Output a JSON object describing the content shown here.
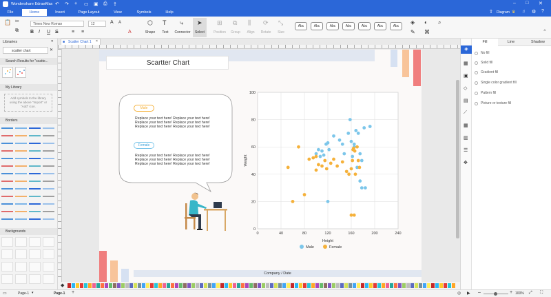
{
  "app": {
    "title": "Wondershare EdrawMax"
  },
  "menu": {
    "tabs": [
      "File",
      "Home",
      "Insert",
      "Page Layout",
      "View",
      "Symbols",
      "Help"
    ],
    "active": "Home",
    "diagram_label": "Diagram"
  },
  "ribbon": {
    "font_name": "Times New Roman",
    "font_size": "12",
    "tools": [
      "Shape",
      "Text",
      "Connector",
      "Select",
      "Position",
      "Group",
      "Align",
      "Rotate",
      "Size"
    ],
    "style_swatches": [
      "Abc",
      "Abc",
      "Abc",
      "Abc",
      "Abc",
      "Abc",
      "Abc"
    ]
  },
  "left_panel": {
    "title": "Libraries",
    "search_value": "scatter chart",
    "search_results_label": "Search Results for \"scatte...",
    "my_library_label": "My Library",
    "my_library_hint": "Add symbols to the library using the above \"Import\" or \"Add\" icon.",
    "borders_label": "Borders",
    "backgrounds_label": "Backgrounds"
  },
  "document_tab": {
    "label": "Scatter Chart 1"
  },
  "canvas": {
    "title": "Scartter Chart",
    "footer": "Company / Date",
    "bubble": {
      "male_label": "Male",
      "female_label": "Female",
      "placeholder": "Replace your text here!"
    }
  },
  "chart_data": {
    "type": "scatter",
    "title": "",
    "xlabel": "Height",
    "ylabel": "Weight",
    "xlim": [
      0,
      240
    ],
    "ylim": [
      0,
      100
    ],
    "x_ticks": [
      0,
      40,
      80,
      120,
      160,
      200,
      240
    ],
    "y_ticks": [
      0,
      20,
      40,
      60,
      80,
      100
    ],
    "grid": true,
    "legend_position": "bottom",
    "series": [
      {
        "name": "Male",
        "color": "#7cc6ea",
        "points": [
          [
            100,
            55
          ],
          [
            104,
            58
          ],
          [
            107,
            53
          ],
          [
            110,
            57
          ],
          [
            113,
            54
          ],
          [
            117,
            62
          ],
          [
            120,
            63
          ],
          [
            122,
            58
          ],
          [
            130,
            68
          ],
          [
            140,
            65
          ],
          [
            148,
            55
          ],
          [
            155,
            70
          ],
          [
            160,
            64
          ],
          [
            162,
            53
          ],
          [
            165,
            60
          ],
          [
            168,
            72
          ],
          [
            172,
            70
          ],
          [
            178,
            50
          ],
          [
            182,
            74
          ],
          [
            192,
            75
          ],
          [
            165,
            62
          ],
          [
            175,
            55
          ],
          [
            170,
            45
          ],
          [
            175,
            35
          ],
          [
            178,
            30
          ],
          [
            184,
            30
          ],
          [
            158,
            80
          ],
          [
            120,
            20
          ],
          [
            145,
            62
          ]
        ]
      },
      {
        "name": "Female",
        "color": "#f5b13a",
        "points": [
          [
            52,
            45
          ],
          [
            60,
            20
          ],
          [
            70,
            60
          ],
          [
            80,
            25
          ],
          [
            88,
            51
          ],
          [
            95,
            52
          ],
          [
            100,
            43
          ],
          [
            104,
            47
          ],
          [
            110,
            46
          ],
          [
            115,
            50
          ],
          [
            118,
            44
          ],
          [
            125,
            48
          ],
          [
            130,
            51
          ],
          [
            136,
            46
          ],
          [
            145,
            49
          ],
          [
            152,
            42
          ],
          [
            156,
            40
          ],
          [
            160,
            44
          ],
          [
            162,
            50
          ],
          [
            163,
            58
          ],
          [
            164,
            59
          ],
          [
            167,
            40
          ],
          [
            170,
            60
          ],
          [
            172,
            50
          ],
          [
            174,
            45
          ],
          [
            166,
            57
          ],
          [
            160,
            10
          ],
          [
            165,
            10
          ],
          [
            100,
            53
          ]
        ]
      }
    ]
  },
  "right_panel": {
    "tabs": [
      "Fill",
      "Line",
      "Shadow"
    ],
    "options": [
      "No fill",
      "Solid fill",
      "Gradient fill",
      "Single color gradient fill",
      "Pattern fill",
      "Picture or texture fill"
    ]
  },
  "status": {
    "page_tab_1": "Page-1",
    "page_tab_2": "Page-1",
    "zoom": "100%"
  }
}
